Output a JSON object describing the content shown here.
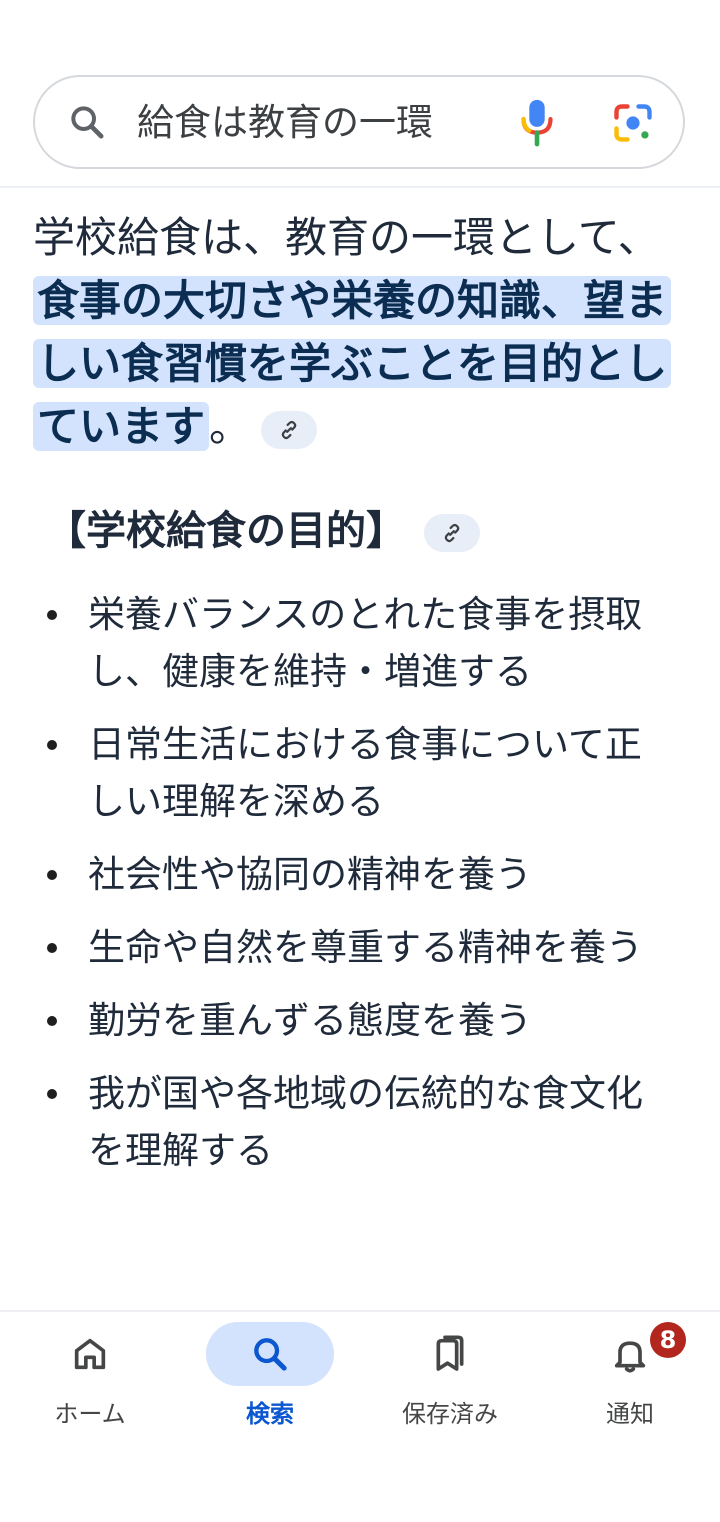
{
  "search": {
    "query": "給食は教育の一環"
  },
  "answer": {
    "lead": "学校給食は、教育の一環として、",
    "highlight": "食事の大切さや栄養の知識、望ましい食習慣を学ぶことを目的としています",
    "tail": "。"
  },
  "section": {
    "heading": "【学校給食の目的】"
  },
  "purposes": [
    "栄養バランスのとれた食事を摂取し、健康を維持・増進する",
    "日常生活における食事について正しい理解を深める",
    "社会性や協同の精神を養う",
    "生命や自然を尊重する精神を養う",
    "勤労を重んずる態度を養う",
    "我が国や各地域の伝統的な食文化を理解する"
  ],
  "nav": {
    "home": "ホーム",
    "search": "検索",
    "saved": "保存済み",
    "notifications": "通知",
    "notifications_badge": "8"
  },
  "colors": {
    "highlight": "#d3e3fd",
    "accent": "#0b57d0",
    "badge": "#b3261e"
  }
}
